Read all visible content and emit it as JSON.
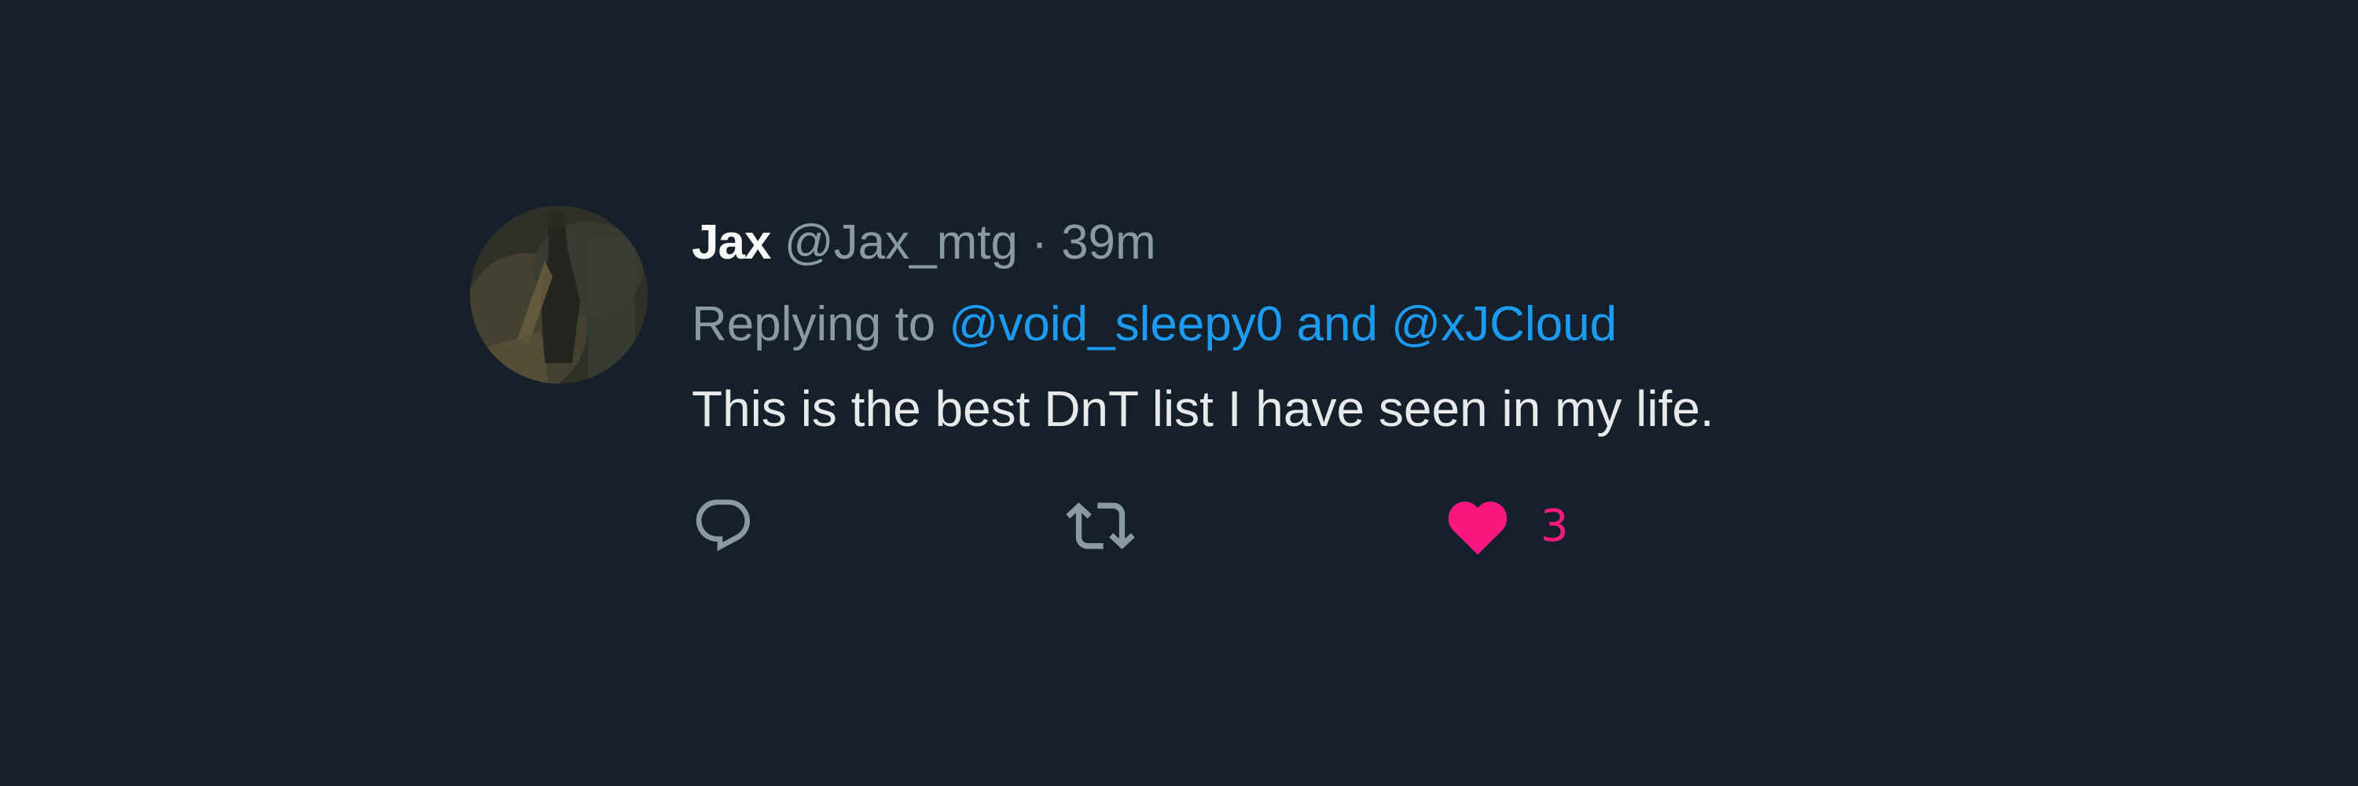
{
  "tweet": {
    "author_name": "Jax",
    "handle": "@Jax_mtg",
    "separator": "·",
    "time": "39m",
    "replying_prefix": "Replying to",
    "replying_mentions": "@void_sleepy0 and @xJCloud",
    "text": "This is the best DnT list I have seen in my life.",
    "like_count": "3",
    "liked": true
  },
  "icons": {
    "reply": "reply-icon",
    "retweet": "retweet-icon",
    "like": "heart-icon"
  },
  "colors": {
    "background": "#15202b",
    "mention": "#1d9bf0",
    "like_active": "#f91880",
    "secondary_text": "#8b98a5"
  }
}
